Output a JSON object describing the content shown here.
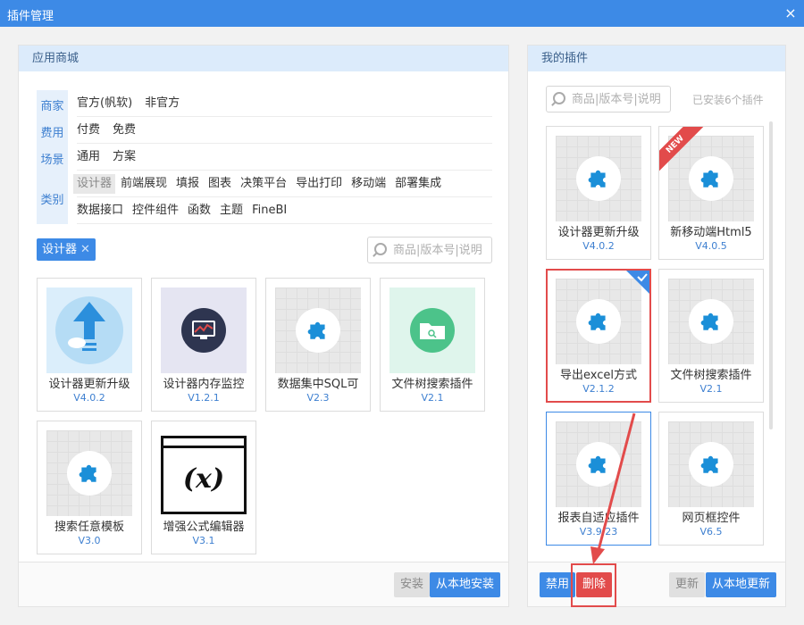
{
  "window": {
    "title": "插件管理",
    "close_label": "×"
  },
  "store": {
    "header": "应用商城",
    "filters": {
      "vendor": {
        "label": "商家",
        "options": [
          "官方(帆软)",
          "非官方"
        ]
      },
      "fee": {
        "label": "费用",
        "options": [
          "付费",
          "免费"
        ]
      },
      "scene": {
        "label": "场景",
        "options": [
          "通用",
          "方案"
        ]
      },
      "category": {
        "label": "类别",
        "row1": [
          "设计器",
          "前端展现",
          "填报",
          "图表",
          "决策平台",
          "导出打印",
          "移动端",
          "部署集成"
        ],
        "row2": [
          "数据接口",
          "控件组件",
          "函数",
          "主题",
          "FineBI"
        ]
      }
    },
    "active_tag": "设计器",
    "tag_close": "✕",
    "search_placeholder": "商品|版本号|说明",
    "cards": [
      {
        "name": "设计器更新升级",
        "version": "V4.0.2"
      },
      {
        "name": "设计器内存监控",
        "version": "V1.2.1"
      },
      {
        "name": "数据集中SQL可",
        "version": "V2.3"
      },
      {
        "name": "文件树搜索插件",
        "version": "V2.1"
      },
      {
        "name": "搜索任意模板",
        "version": "V3.0"
      },
      {
        "name": "增强公式编辑器",
        "version": "V3.1",
        "formula": "(x)"
      }
    ],
    "install_label": "安装",
    "local_install_label": "从本地安装"
  },
  "mine": {
    "header": "我的插件",
    "search_placeholder": "商品|版本号|说明",
    "installed_count": "已安装6个插件",
    "new_badge": "NEW",
    "cards": [
      {
        "name": "设计器更新升级",
        "version": "V4.0.2"
      },
      {
        "name": "新移动端Html5",
        "version": "V4.0.5"
      },
      {
        "name": "导出excel方式",
        "version": "V2.1.2"
      },
      {
        "name": "文件树搜索插件",
        "version": "V2.1"
      },
      {
        "name": "报表自适应插件",
        "version": "V3.9.23"
      },
      {
        "name": "网页框控件",
        "version": "V6.5"
      }
    ],
    "disable_label": "禁用",
    "delete_label": "删除",
    "update_label": "更新",
    "local_update_label": "从本地更新"
  },
  "colors": {
    "accent": "#3d8ae6",
    "header_bg": "#dcebfb",
    "danger": "#e24b4b",
    "puzzle": "#1b8fd8"
  }
}
